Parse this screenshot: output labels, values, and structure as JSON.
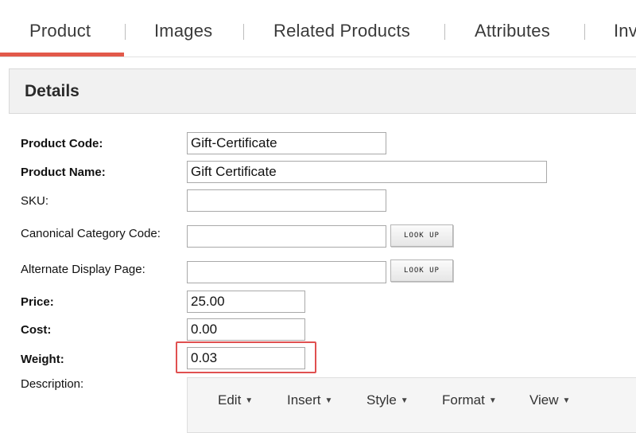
{
  "tabs": [
    {
      "label": "Product",
      "active": true
    },
    {
      "label": "Images"
    },
    {
      "label": "Related Products"
    },
    {
      "label": "Attributes"
    },
    {
      "label": "Inv"
    }
  ],
  "details": {
    "title": "Details"
  },
  "form": {
    "product_code_label": "Product Code:",
    "product_code_value": "Gift-Certificate",
    "product_name_label": "Product Name:",
    "product_name_value": "Gift Certificate",
    "sku_label": "SKU:",
    "sku_value": "",
    "canonical_category_label": "Canonical Category Code:",
    "canonical_category_value": "",
    "alternate_display_label": "Alternate Display Page:",
    "alternate_display_value": "",
    "lookup_label": "LOOK UP",
    "price_label": "Price:",
    "price_value": "25.00",
    "cost_label": "Cost:",
    "cost_value": "0.00",
    "weight_label": "Weight:",
    "weight_value": "0.03",
    "description_label": "Description:"
  },
  "editor": {
    "menus": [
      {
        "label": "Edit"
      },
      {
        "label": "Insert"
      },
      {
        "label": "Style"
      },
      {
        "label": "Format"
      },
      {
        "label": "View"
      }
    ]
  },
  "colors": {
    "active_tab_bar": "#e2594a",
    "highlight_box": "#e05050"
  }
}
